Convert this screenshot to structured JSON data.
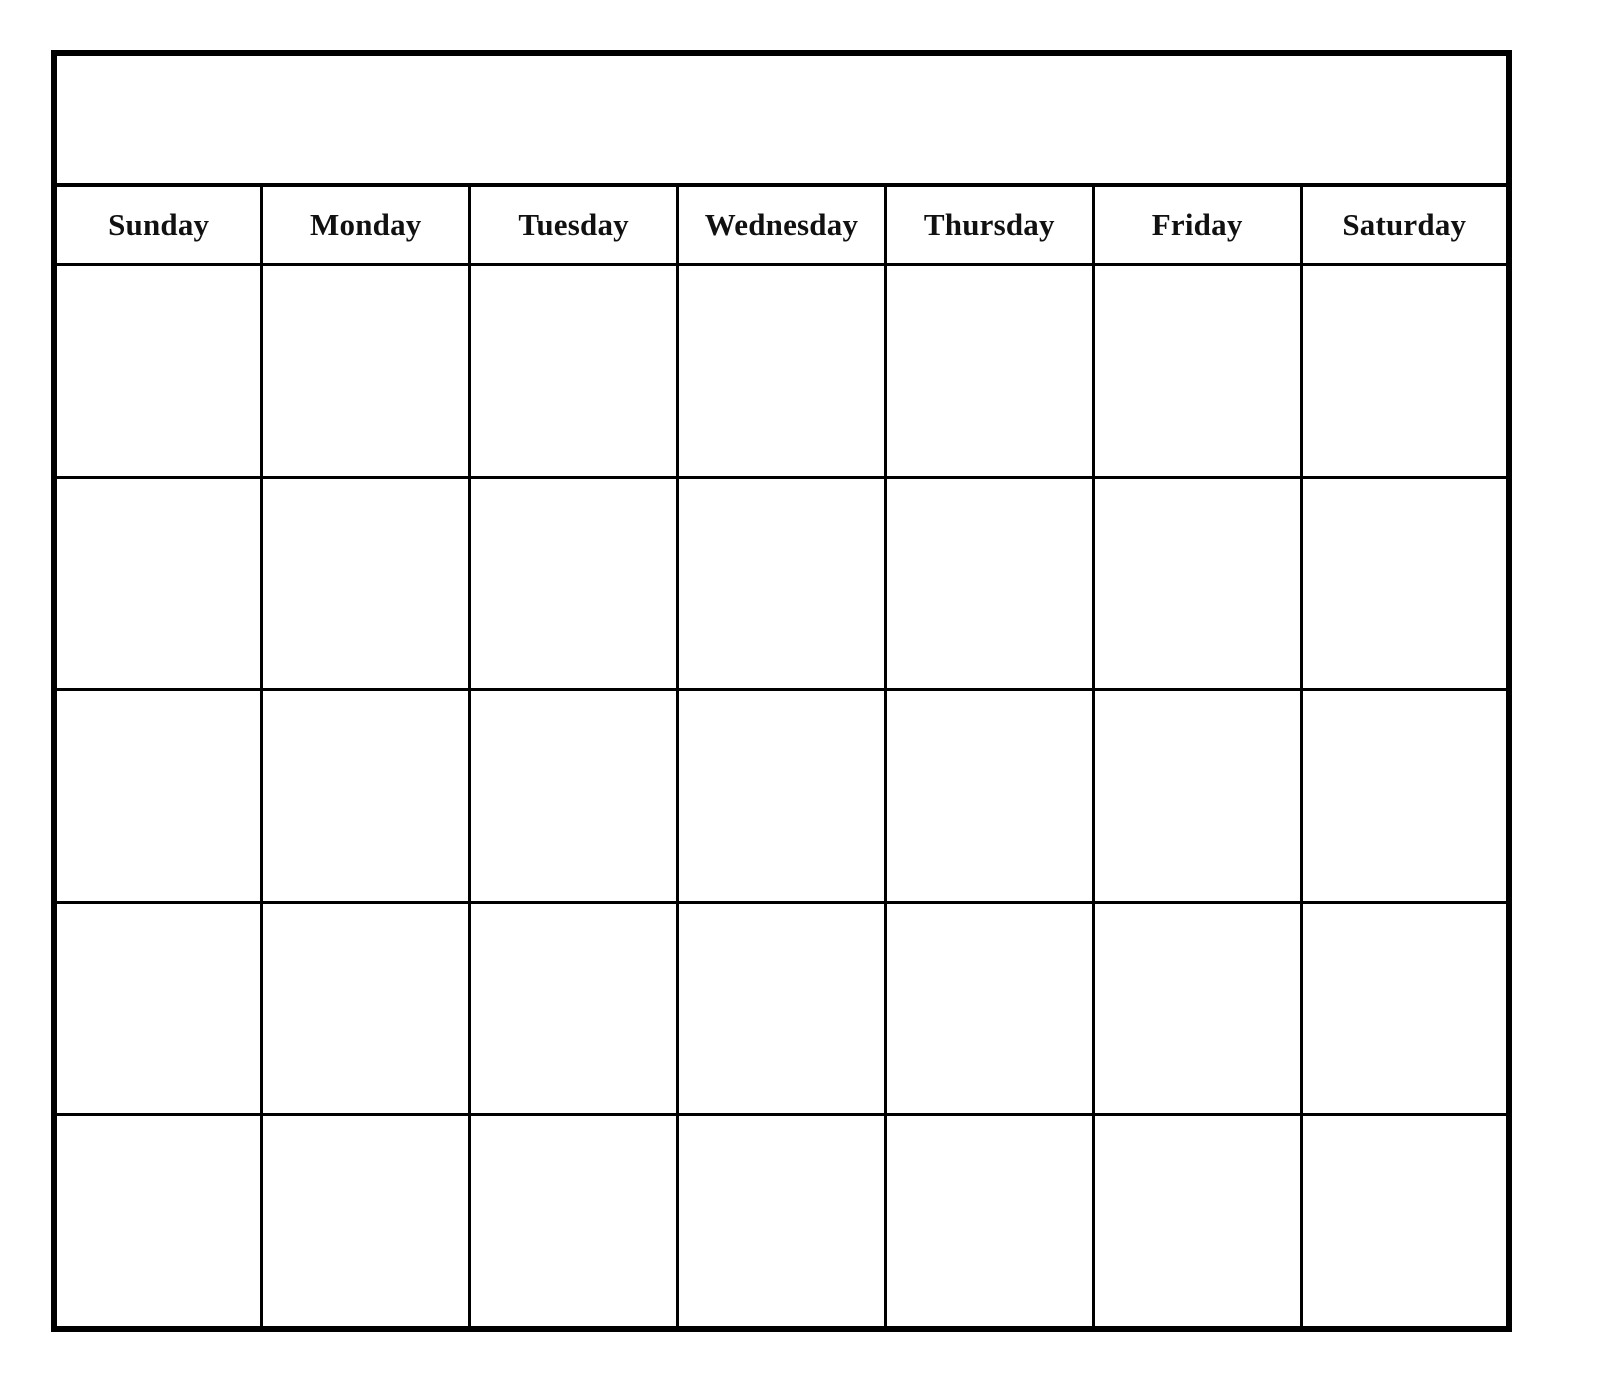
{
  "document": {
    "type": "blank-monthly-calendar-template",
    "title_banner": {
      "text": "",
      "placeholder": ""
    }
  },
  "colors": {
    "border": "#000000",
    "background": "#ffffff",
    "text": "#000000"
  },
  "calendar": {
    "day_headers": [
      "Sunday",
      "Monday",
      "Tuesday",
      "Wednesday",
      "Thursday",
      "Friday",
      "Saturday"
    ],
    "weeks": [
      {
        "cells": [
          "",
          "",
          "",
          "",
          "",
          "",
          ""
        ]
      },
      {
        "cells": [
          "",
          "",
          "",
          "",
          "",
          "",
          ""
        ]
      },
      {
        "cells": [
          "",
          "",
          "",
          "",
          "",
          "",
          ""
        ]
      },
      {
        "cells": [
          "",
          "",
          "",
          "",
          "",
          "",
          ""
        ]
      },
      {
        "cells": [
          "",
          "",
          "",
          "",
          "",
          "",
          ""
        ]
      }
    ]
  }
}
